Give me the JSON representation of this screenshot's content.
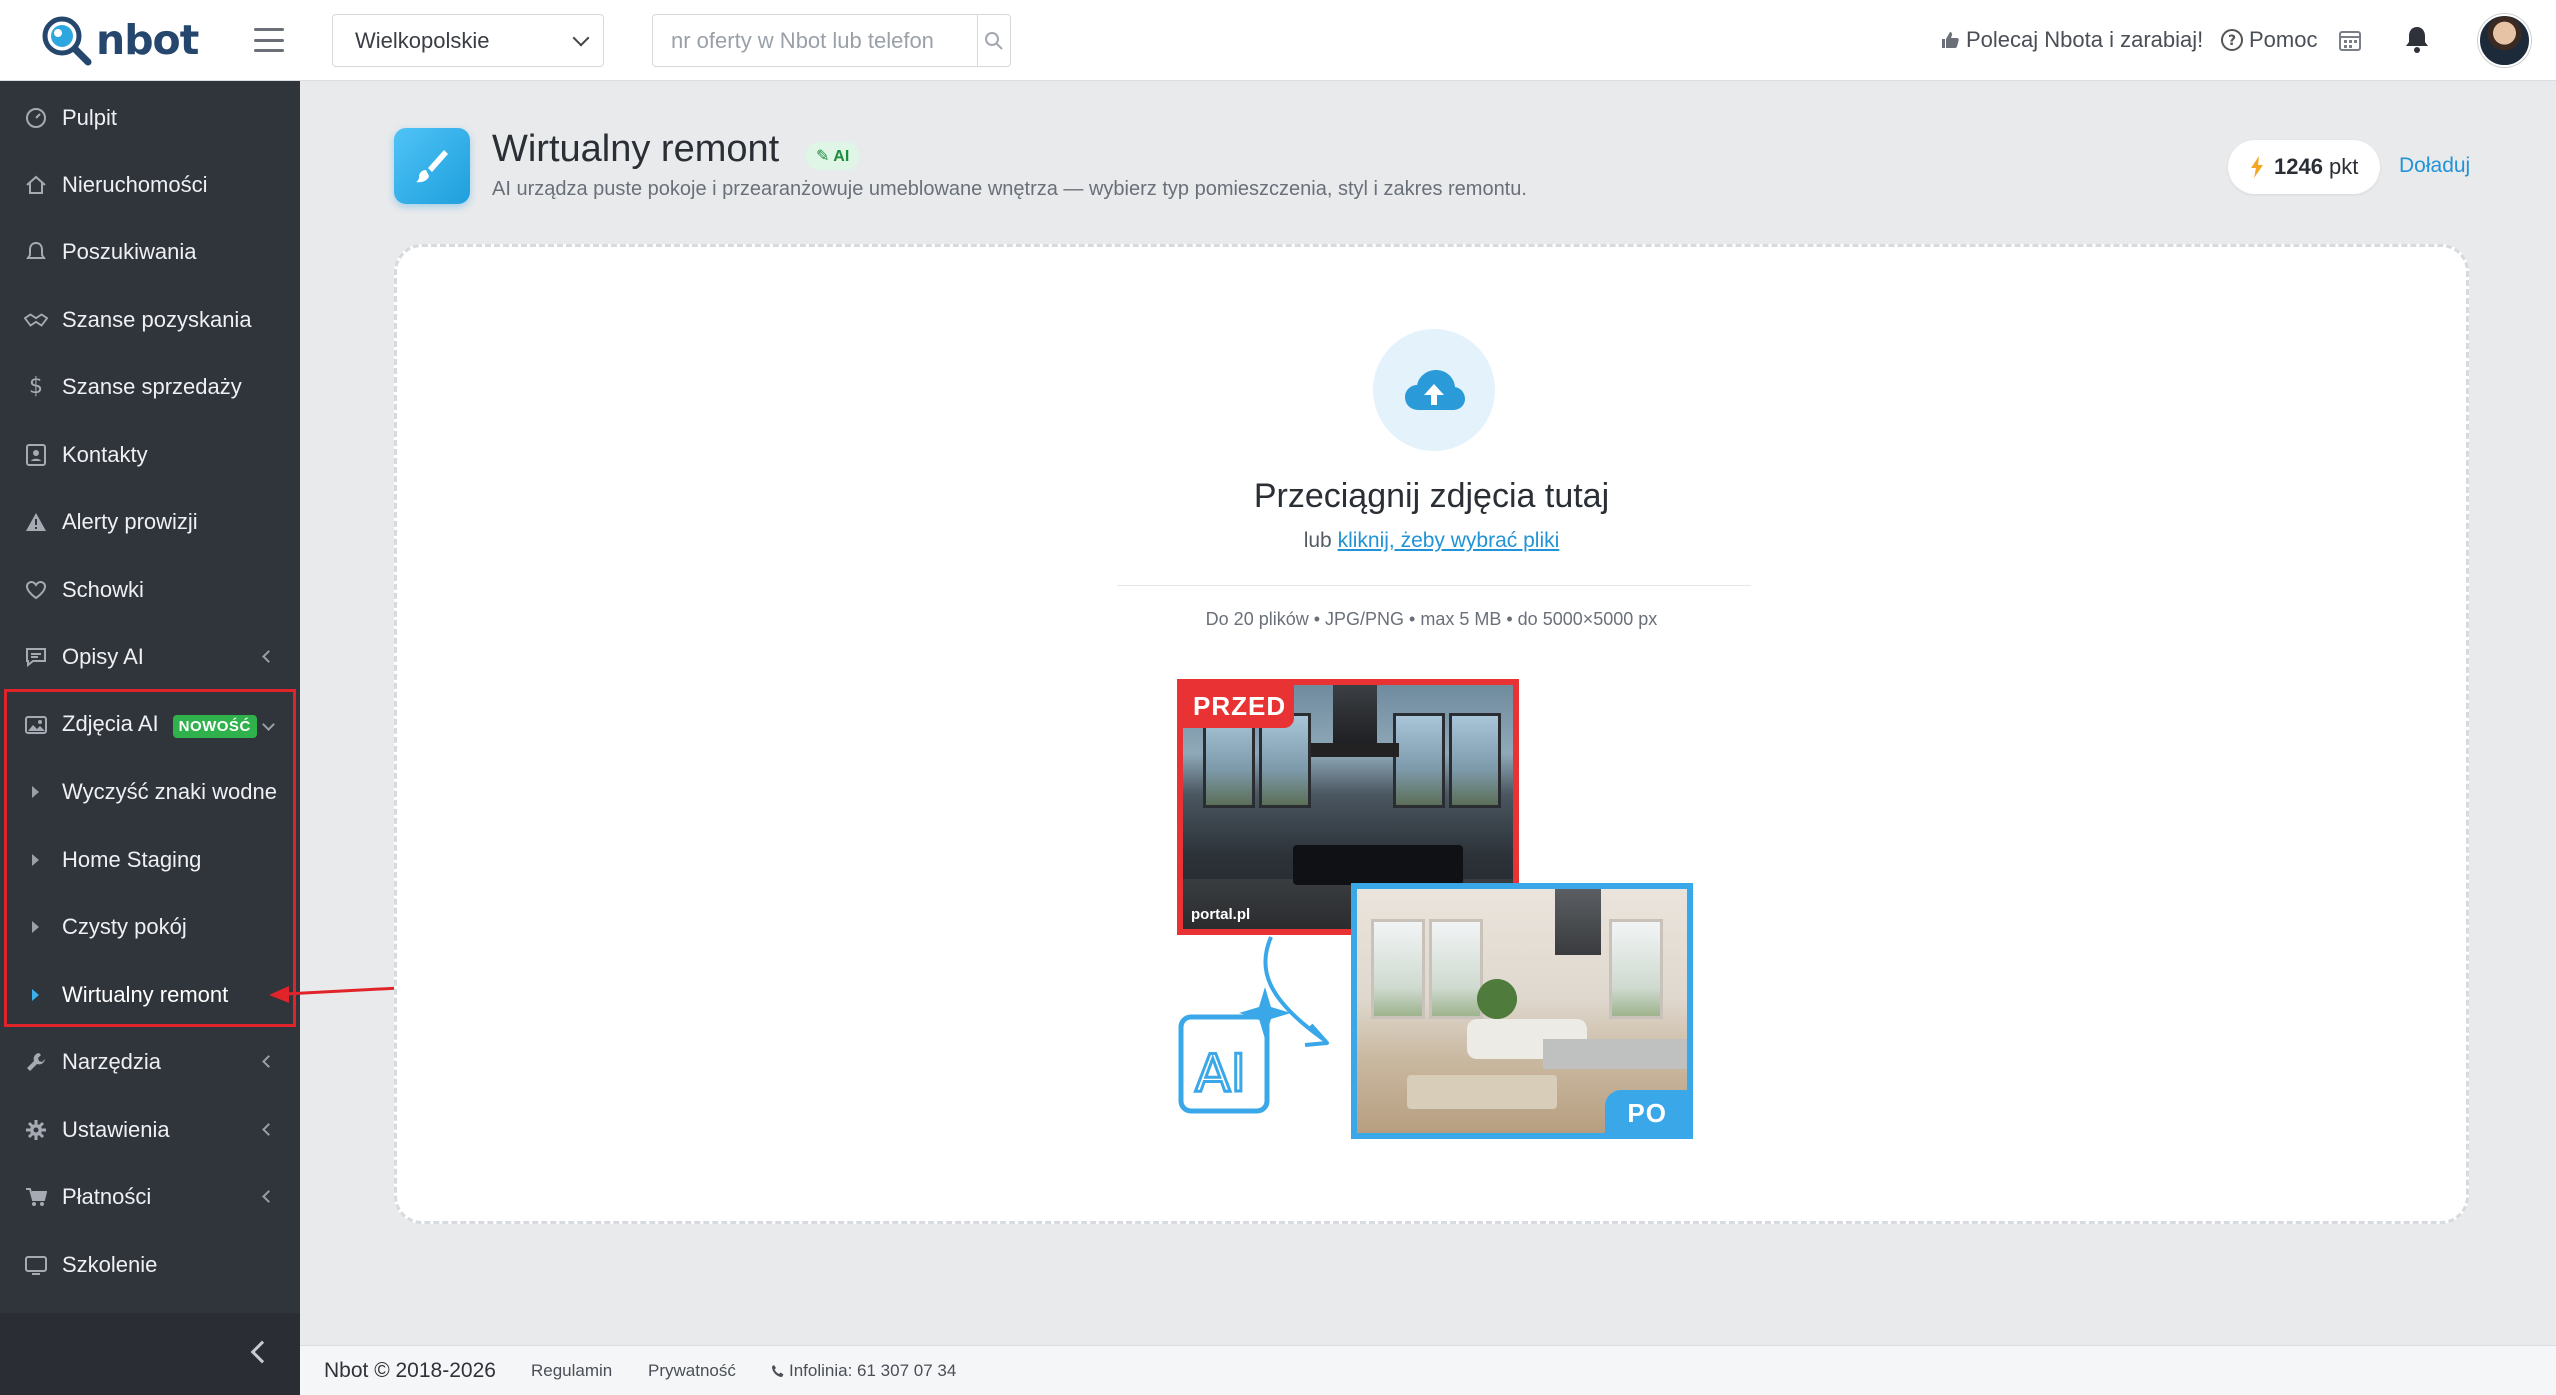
{
  "brand": {
    "name": "nbot"
  },
  "header": {
    "region_value": "Wielkopolskie",
    "search_placeholder": "nr oferty w Nbot lub telefon",
    "recommend_label": "Polecaj Nbota i zarabiaj!",
    "help_label": "Pomoc"
  },
  "sidebar": {
    "items": [
      {
        "label": "Pulpit",
        "icon": "dashboard-icon"
      },
      {
        "label": "Nieruchomości",
        "icon": "home-icon"
      },
      {
        "label": "Poszukiwania",
        "icon": "bell-icon"
      },
      {
        "label": "Szanse pozyskania",
        "icon": "handshake-icon"
      },
      {
        "label": "Szanse sprzedaży",
        "icon": "dollar-icon"
      },
      {
        "label": "Kontakty",
        "icon": "contact-card-icon"
      },
      {
        "label": "Alerty prowizji",
        "icon": "warning-icon"
      },
      {
        "label": "Schowki",
        "icon": "heart-icon"
      },
      {
        "label": "Opisy AI",
        "icon": "comment-icon"
      },
      {
        "label": "Zdjęcia AI",
        "icon": "image-icon",
        "badge": "NOWOŚĆ"
      },
      {
        "label": "Narzędzia",
        "icon": "wrench-icon"
      },
      {
        "label": "Ustawienia",
        "icon": "gear-icon"
      },
      {
        "label": "Płatności",
        "icon": "cart-icon"
      },
      {
        "label": "Szkolenie",
        "icon": "tv-icon"
      }
    ],
    "sub_items": [
      {
        "label": "Wyczyść znaki wodne"
      },
      {
        "label": "Home Staging"
      },
      {
        "label": "Czysty pokój"
      },
      {
        "label": "Wirtualny remont",
        "active": true
      }
    ]
  },
  "page": {
    "title": "Wirtualny remont",
    "ai_badge": "AI",
    "subtitle": "AI urządza puste pokoje i przearanżowuje umeblowane wnętrza — wybierz typ pomieszczenia, styl i zakres remontu.",
    "points_value": "1246",
    "points_unit": "pkt",
    "topup_label": "Doładuj"
  },
  "dropzone": {
    "title": "Przeciągnij zdjęcia tutaj",
    "or_text": "lub",
    "link_text": "kliknij, żeby wybrać pliki",
    "limits": "Do 20 plików • JPG/PNG • max 5 MB • do 5000×5000 px",
    "before_label": "PRZED",
    "after_label": "PO",
    "watermark": "portal.pl",
    "ai_mark": "AI"
  },
  "footer": {
    "copyright": "Nbot © 2018-2026",
    "terms": "Regulamin",
    "privacy": "Prywatność",
    "hotline": "Infolinia: 61 307 07 34"
  },
  "colors": {
    "sidebar_bg": "#30343b",
    "accent": "#2193d6",
    "highlight": "#e0242a",
    "before_red": "#e83233",
    "after_blue": "#3aa8e8",
    "new_badge": "#2fb24c"
  }
}
